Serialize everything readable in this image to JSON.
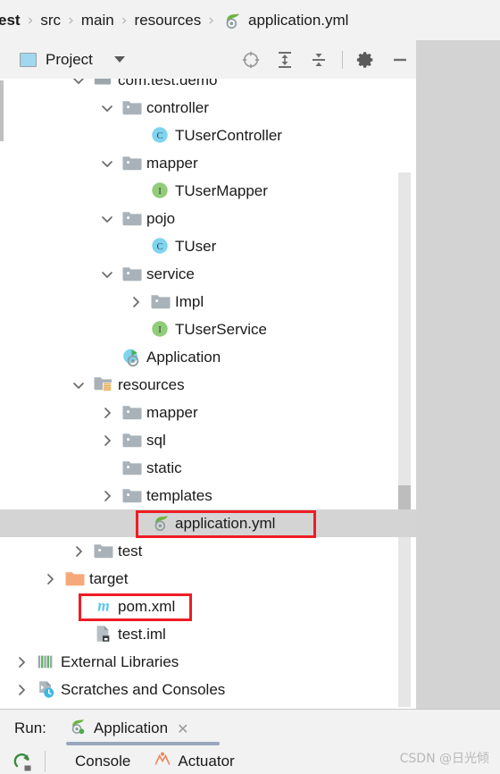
{
  "breadcrumb": {
    "name": "breadcrumb",
    "items": [
      {
        "label": "est",
        "icon": null,
        "truncated": true
      },
      {
        "label": "src",
        "icon": null
      },
      {
        "label": "main",
        "icon": null
      },
      {
        "label": "resources",
        "icon": null
      },
      {
        "label": "application.yml",
        "icon": "spring-config-icon"
      }
    ],
    "separator": "›"
  },
  "panel": {
    "title": "Project",
    "title_icon": "project-view-icon",
    "dropdown_icon": "chevron-down-icon",
    "tools": [
      {
        "name": "locate-in-tree-icon",
        "title": "Select Opened File"
      },
      {
        "name": "expand-all-icon",
        "title": "Expand All"
      },
      {
        "name": "collapse-all-icon",
        "title": "Collapse All"
      },
      {
        "name": "settings-gear-icon",
        "title": "Settings"
      },
      {
        "name": "minimize-icon",
        "title": "Hide"
      }
    ]
  },
  "tree": {
    "rows": [
      {
        "label": "com.test.demo",
        "icon": "package-icon",
        "arrow": "chevron-down",
        "indent": 3,
        "partial": true,
        "selected": false
      },
      {
        "label": "controller",
        "icon": "folder-icon",
        "arrow": "chevron-down",
        "indent": 4,
        "selected": false
      },
      {
        "label": "TUserController",
        "icon": "class-icon",
        "arrow": null,
        "indent": 5,
        "selected": false
      },
      {
        "label": "mapper",
        "icon": "folder-icon",
        "arrow": "chevron-down",
        "indent": 4,
        "selected": false
      },
      {
        "label": "TUserMapper",
        "icon": "interface-icon",
        "arrow": null,
        "indent": 5,
        "selected": false
      },
      {
        "label": "pojo",
        "icon": "folder-icon",
        "arrow": "chevron-down",
        "indent": 4,
        "selected": false
      },
      {
        "label": "TUser",
        "icon": "class-icon",
        "arrow": null,
        "indent": 5,
        "selected": false
      },
      {
        "label": "service",
        "icon": "folder-icon",
        "arrow": "chevron-down",
        "indent": 4,
        "selected": false
      },
      {
        "label": "Impl",
        "icon": "folder-icon",
        "arrow": "chevron-right",
        "indent": 5,
        "selected": false
      },
      {
        "label": "TUserService",
        "icon": "interface-icon",
        "arrow": null,
        "indent": 5,
        "selected": false
      },
      {
        "label": "Application",
        "icon": "spring-boot-class-icon",
        "arrow": null,
        "indent": 4,
        "selected": false
      },
      {
        "label": "resources",
        "icon": "resources-folder-icon",
        "arrow": "chevron-down",
        "indent": 3,
        "selected": false
      },
      {
        "label": "mapper",
        "icon": "folder-icon",
        "arrow": "chevron-right",
        "indent": 4,
        "selected": false
      },
      {
        "label": "sql",
        "icon": "folder-icon",
        "arrow": "chevron-right",
        "indent": 4,
        "selected": false
      },
      {
        "label": "static",
        "icon": "folder-icon",
        "arrow": null,
        "indent": 4,
        "selected": false
      },
      {
        "label": "templates",
        "icon": "folder-icon",
        "arrow": "chevron-right",
        "indent": 4,
        "selected": false
      },
      {
        "label": "application.yml",
        "icon": "spring-config-icon",
        "arrow": null,
        "indent": 5,
        "selected": true,
        "annotated": true
      },
      {
        "label": "test",
        "icon": "folder-icon",
        "arrow": "chevron-right",
        "indent": 3,
        "selected": false
      },
      {
        "label": "target",
        "icon": "excluded-folder-icon",
        "arrow": "chevron-right",
        "indent": 2,
        "selected": false
      },
      {
        "label": "pom.xml",
        "icon": "maven-icon",
        "arrow": null,
        "indent": 3,
        "selected": false,
        "annotated": true
      },
      {
        "label": "test.iml",
        "icon": "iml-file-icon",
        "arrow": null,
        "indent": 3,
        "selected": false
      },
      {
        "label": "External Libraries",
        "icon": "libraries-icon",
        "arrow": "chevron-right",
        "indent": 1,
        "selected": false
      },
      {
        "label": "Scratches and Consoles",
        "icon": "scratches-icon",
        "arrow": "chevron-right",
        "indent": 1,
        "selected": false
      }
    ]
  },
  "run_panel": {
    "run_label": "Run:",
    "tab": {
      "name": "Application",
      "icon": "spring-boot-run-icon",
      "close_icon": "close-icon",
      "close_glyph": "✕"
    },
    "rerun_icon": "rerun-icon",
    "sub_tabs": [
      {
        "label": "Console",
        "icon": null
      },
      {
        "label": "Actuator",
        "icon": "actuator-icon"
      }
    ]
  },
  "watermark": "CSDN @日光倾",
  "colors": {
    "selection": "#d4d4d4",
    "annotation": "#ee1c25",
    "class_icon": "#7fd3ee",
    "interface_icon": "#92cc7a",
    "maven_icon": "#5cc6e8",
    "excluded_folder": "#f5a87a",
    "spring_green": "#6db33f",
    "panel_bg": "#f2f2f2",
    "tree_bg": "#ffffff",
    "editor_bg": "#d3d3d3"
  }
}
